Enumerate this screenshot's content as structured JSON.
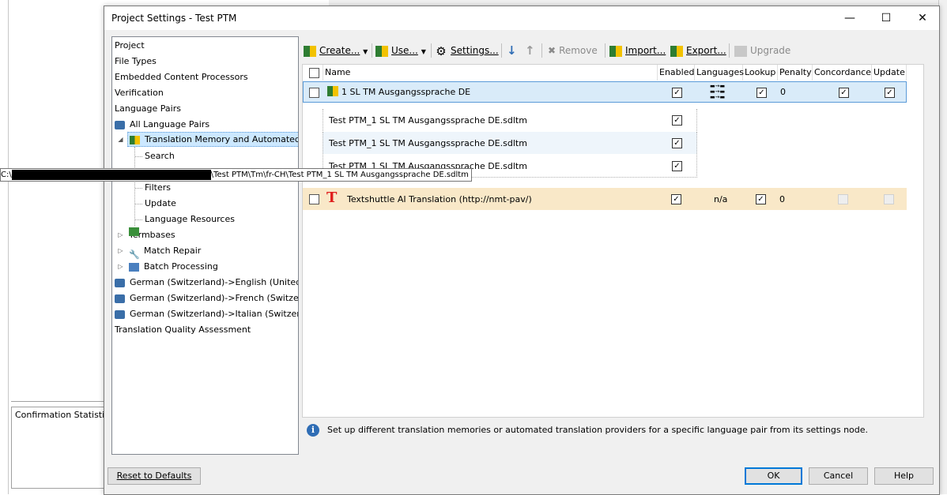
{
  "background": {
    "stats_tab": "Confirmation Statistics"
  },
  "dialog": {
    "title": "Project Settings - Test PTM",
    "minimize": "—",
    "maximize": "☐",
    "close": "✕"
  },
  "tree": {
    "items": [
      {
        "label": "Project"
      },
      {
        "label": "File Types"
      },
      {
        "label": "Embedded Content Processors"
      },
      {
        "label": "Verification"
      },
      {
        "label": "Language Pairs"
      },
      {
        "label": "All Language Pairs"
      },
      {
        "label": "Translation Memory and Automated Tr"
      },
      {
        "label": "Search"
      },
      {
        "label": "Filters"
      },
      {
        "label": "Update"
      },
      {
        "label": "Language Resources"
      },
      {
        "label": "Termbases"
      },
      {
        "label": "Match Repair"
      },
      {
        "label": "Batch Processing"
      },
      {
        "label": "German (Switzerland)->English (United Ki"
      },
      {
        "label": "German (Switzerland)->French (Switzerlan"
      },
      {
        "label": "German (Switzerland)->Italian (Switzerlan"
      },
      {
        "label": "Translation Quality Assessment"
      }
    ]
  },
  "tooltip": {
    "prefix": "C:\\",
    "path": "\\Test PTM\\Tm\\fr-CH\\Test PTM_1 SL TM Ausgangssprache DE.sdltm"
  },
  "toolbar": {
    "create": "Create...",
    "use": "Use...",
    "settings": "Settings...",
    "remove": "Remove",
    "import": "Import...",
    "export": "Export...",
    "upgrade": "Upgrade"
  },
  "grid": {
    "headers": [
      "Name",
      "Enabled",
      "Languages",
      "Lookup",
      "Penalty",
      "Concordance",
      "Update"
    ],
    "rows": [
      {
        "name": "1 SL TM Ausgangssprache DE",
        "penalty": "0"
      },
      {
        "name": "Test PTM_1 SL TM Ausgangssprache DE.sdltm"
      },
      {
        "name": "Test PTM_1 SL TM Ausgangssprache DE.sdltm"
      },
      {
        "name": "Test PTM_1 SL TM Ausgangssprache DE.sdltm"
      },
      {
        "name": "Textshuttle AI Translation (http://nmt-pav/)",
        "languages": "n/a",
        "penalty": "0"
      }
    ]
  },
  "info_text": "Set up different translation memories or automated translation providers for a specific language pair from its settings node.",
  "buttons": {
    "reset": "Reset to Defaults",
    "ok": "OK",
    "cancel": "Cancel",
    "help": "Help"
  },
  "colors": {
    "selected_row": "#d9ebf9",
    "mt_row": "#f9e8c8",
    "accent": "#0078d7"
  }
}
